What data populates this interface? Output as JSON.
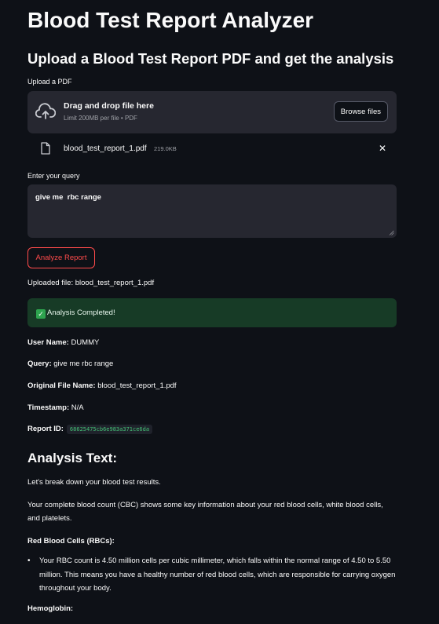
{
  "page": {
    "title": "Blood Test Report Analyzer",
    "subtitle": "Upload a Blood Test Report PDF and get the analysis"
  },
  "uploader": {
    "label": "Upload a PDF",
    "drop_title": "Drag and drop file here",
    "drop_hint": "Limit 200MB per file • PDF",
    "browse_label": "Browse files",
    "file_name": "blood_test_report_1.pdf",
    "file_size": "219.0KB",
    "remove_symbol": "✕"
  },
  "query": {
    "label": "Enter your query",
    "value": "give me  rbc range"
  },
  "analyze_label": "Analyze Report",
  "uploaded_file_text": "Uploaded file: blood_test_report_1.pdf",
  "success": {
    "icon": "check-icon",
    "text": "Analysis Completed!",
    "color": "#173b26"
  },
  "details": {
    "user_name_label": "User Name:",
    "user_name": "DUMMY",
    "query_label": "Query:",
    "query": "give me rbc range",
    "original_file_label": "Original File Name:",
    "original_file": "blood_test_report_1.pdf",
    "timestamp_label": "Timestamp:",
    "timestamp": "N/A",
    "report_id_label": "Report ID:",
    "report_id": "68625475cb6e983a371ce6da"
  },
  "analysis": {
    "heading": "Analysis Text:",
    "intro": "Let's break down your blood test results.",
    "cbc_paragraph": "Your complete blood count (CBC) shows some key information about your red blood cells, white blood cells, and platelets.",
    "rbc_heading": "Red Blood Cells (RBCs):",
    "rbc_bullet": "Your RBC count is 4.50 million cells per cubic millimeter, which falls within the normal range of 4.50 to 5.50 million. This means you have a healthy number of red blood cells, which are responsible for carrying oxygen throughout your body.",
    "hemoglobin_heading": "Hemoglobin:"
  },
  "colors": {
    "background": "#0e1117",
    "panel": "#262730",
    "accent": "#ff4b4b",
    "code_text": "#44c176"
  }
}
